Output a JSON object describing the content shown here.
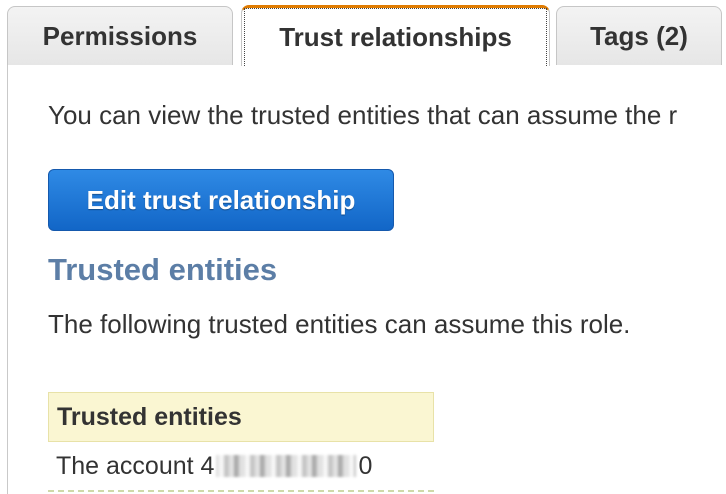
{
  "tabs": {
    "permissions": "Permissions",
    "trust_relationships": "Trust relationships",
    "tags": "Tags (2)"
  },
  "intro_text": "You can view the trusted entities that can assume the r",
  "edit_button_label": "Edit trust relationship",
  "section": {
    "title": "Trusted entities",
    "description": "The following trusted entities can assume this role."
  },
  "table": {
    "header": "Trusted entities",
    "rows": [
      {
        "prefix": "The account 4",
        "suffix": "0"
      }
    ]
  },
  "colors": {
    "active_tab_accent": "#e07b00",
    "button_primary": "#1266c7",
    "section_title": "#5c7ea6",
    "table_header_bg": "#faf6d2"
  }
}
